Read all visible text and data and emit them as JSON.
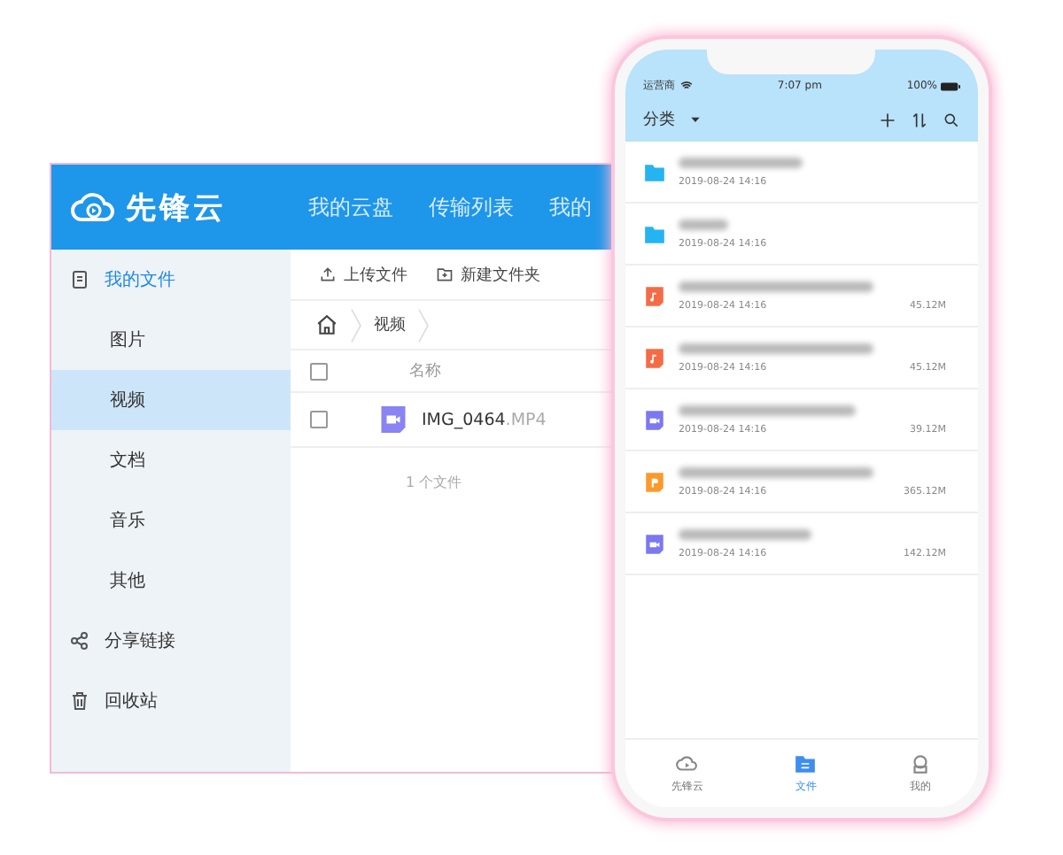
{
  "desktop": {
    "logo": "先锋云",
    "nav": [
      {
        "label": "我的云盘"
      },
      {
        "label": "传输列表"
      },
      {
        "label": "我的"
      }
    ],
    "sidebar": [
      {
        "label": "我的文件",
        "kind": "files",
        "highlighted": true,
        "selected": false
      },
      {
        "label": "图片",
        "kind": "sub",
        "highlighted": false,
        "selected": false
      },
      {
        "label": "视频",
        "kind": "sub",
        "highlighted": false,
        "selected": true
      },
      {
        "label": "文档",
        "kind": "sub",
        "highlighted": false,
        "selected": false
      },
      {
        "label": "音乐",
        "kind": "sub",
        "highlighted": false,
        "selected": false
      },
      {
        "label": "其他",
        "kind": "sub",
        "highlighted": false,
        "selected": false
      },
      {
        "label": "分享链接",
        "kind": "share",
        "highlighted": false,
        "selected": false
      },
      {
        "label": "回收站",
        "kind": "trash",
        "highlighted": false,
        "selected": false
      }
    ],
    "toolbar": [
      {
        "label": "上传文件",
        "kind": "upload"
      },
      {
        "label": "新建文件夹",
        "kind": "folder"
      }
    ],
    "breadcrumb": [
      "视频"
    ],
    "table": {
      "select_all_checked": false,
      "columns": [
        "名称"
      ],
      "rows": [
        {
          "name": "IMG_0464",
          "ext": ".MP4",
          "checked": false
        }
      ]
    },
    "status": "1 个文件"
  },
  "phone": {
    "status_bar": {
      "carrier": "运营商",
      "time": "7:07 pm",
      "battery": "100%"
    },
    "title": "分类",
    "files": [
      {
        "kind": "folder",
        "date": "2019-08-24 14:16"
      },
      {
        "kind": "folder",
        "date": "2019-08-24 14:16"
      },
      {
        "kind": "audio",
        "date": "2019-08-24 14:16",
        "size": "45.12M"
      },
      {
        "kind": "audio",
        "date": "2019-08-24 14:16",
        "size": "45.12M"
      },
      {
        "kind": "video",
        "date": "2019-08-24 14:16",
        "size": "39.12M"
      },
      {
        "kind": "doc",
        "date": "2019-08-24 14:16",
        "size": "365.12M"
      },
      {
        "kind": "video",
        "date": "2019-08-24 14:16",
        "size": "142.12M"
      }
    ],
    "tabs": [
      {
        "label": "先锋云",
        "kind": "cloud",
        "selected": false
      },
      {
        "label": "文件",
        "kind": "files",
        "selected": true
      },
      {
        "label": "我的",
        "kind": "user",
        "selected": false
      }
    ]
  }
}
